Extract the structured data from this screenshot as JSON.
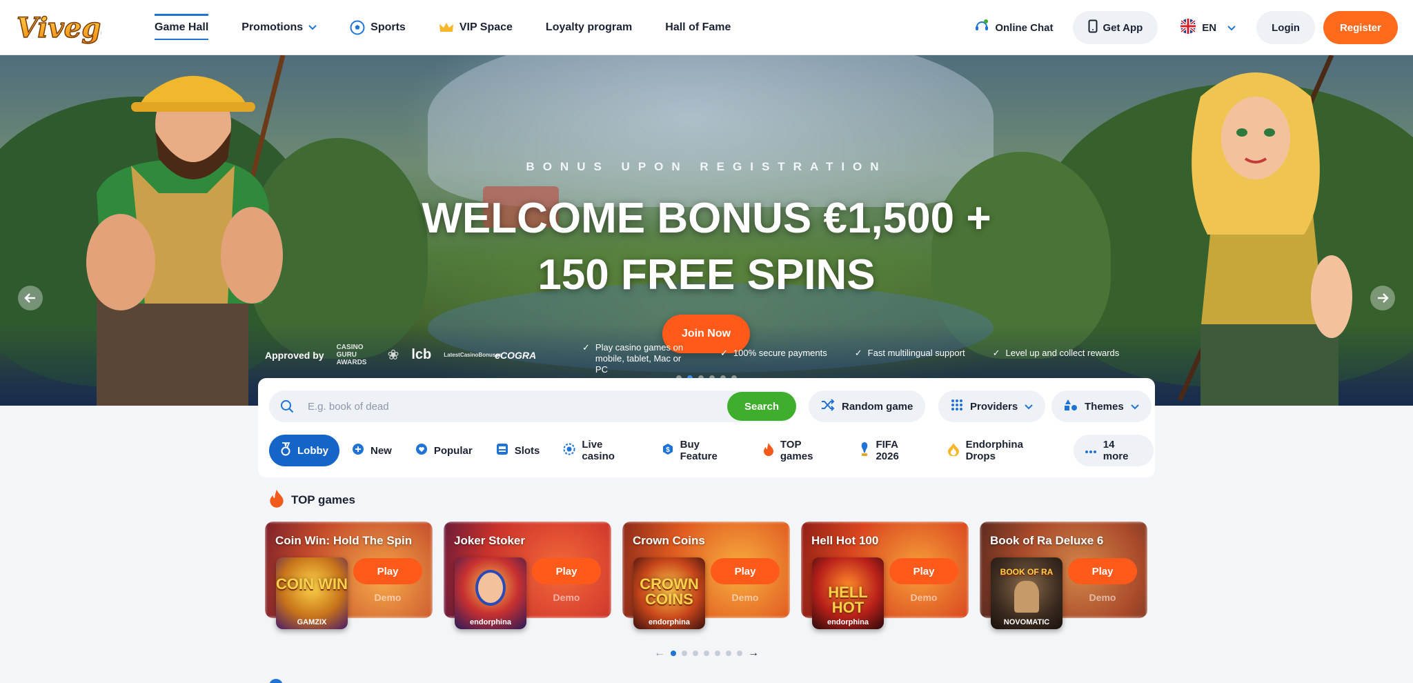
{
  "header": {
    "logo_text": "Vivegas",
    "nav": [
      {
        "label": "Game Hall",
        "icon": "none"
      },
      {
        "label": "Promotions",
        "icon": "chevron-down-icon"
      },
      {
        "label": "Sports",
        "icon": "soccer-ball-icon"
      },
      {
        "label": "VIP Space",
        "icon": "crown-icon"
      },
      {
        "label": "Loyalty program",
        "icon": "none"
      },
      {
        "label": "Hall of Fame",
        "icon": "none"
      }
    ],
    "online_chat": "Online Chat",
    "get_app": "Get App",
    "language": "EN",
    "login": "Login",
    "register": "Register"
  },
  "hero": {
    "subtitle": "BONUS UPON REGISTRATION",
    "title_line1": "WELCOME BONUS €1,500 +",
    "title_line2": "150 FREE SPINS",
    "join_button": "Join Now",
    "slide_count": 6,
    "active_slide": 2,
    "approved_by": "Approved by",
    "badges": [
      "CASINO GURU AWARDS",
      "lcb",
      "LatestCasinoBonuses",
      "eCOGRA"
    ],
    "features": [
      "Play casino games on mobile, tablet, Mac or PC",
      "100% secure payments",
      "Fast multilingual support",
      "Level up and collect rewards"
    ]
  },
  "search": {
    "placeholder": "E.g. book of dead",
    "button": "Search",
    "random_game": "Random game",
    "providers": "Providers",
    "themes": "Themes"
  },
  "categories": [
    {
      "label": "Lobby",
      "icon": "medal-icon"
    },
    {
      "label": "New",
      "icon": "plus-circle-icon"
    },
    {
      "label": "Popular",
      "icon": "heart-icon"
    },
    {
      "label": "Slots",
      "icon": "slot-machine-icon"
    },
    {
      "label": "Live casino",
      "icon": "live-icon"
    },
    {
      "label": "Buy Feature",
      "icon": "dollar-icon"
    },
    {
      "label": "TOP games",
      "icon": "fire-icon"
    },
    {
      "label": "FIFA 2026",
      "icon": "trophy-icon"
    },
    {
      "label": "Endorphina Drops",
      "icon": "flame-drop-icon"
    },
    {
      "label": "14 more",
      "icon": "dots-icon"
    }
  ],
  "top_games": {
    "title": "TOP games",
    "play_label": "Play",
    "demo_label": "Demo",
    "games": [
      {
        "name": "Coin Win: Hold The Spin",
        "thumb": "COIN WIN",
        "provider": "GAMZIX"
      },
      {
        "name": "Joker Stoker",
        "thumb": "",
        "provider": "endorphina"
      },
      {
        "name": "Crown Coins",
        "thumb": "CROWN COINS",
        "provider": "endorphina"
      },
      {
        "name": "Hell Hot 100",
        "thumb": "HELL HOT",
        "provider": "endorphina"
      },
      {
        "name": "Book of Ra Deluxe 6",
        "thumb": "BOOK OF RA",
        "provider": "NOVOMATIC"
      }
    ],
    "page_count": 7,
    "active_page": 1
  },
  "colors": {
    "accent_orange": "#ff6a1c",
    "primary_blue": "#1565c9",
    "search_green": "#3fae2d"
  }
}
